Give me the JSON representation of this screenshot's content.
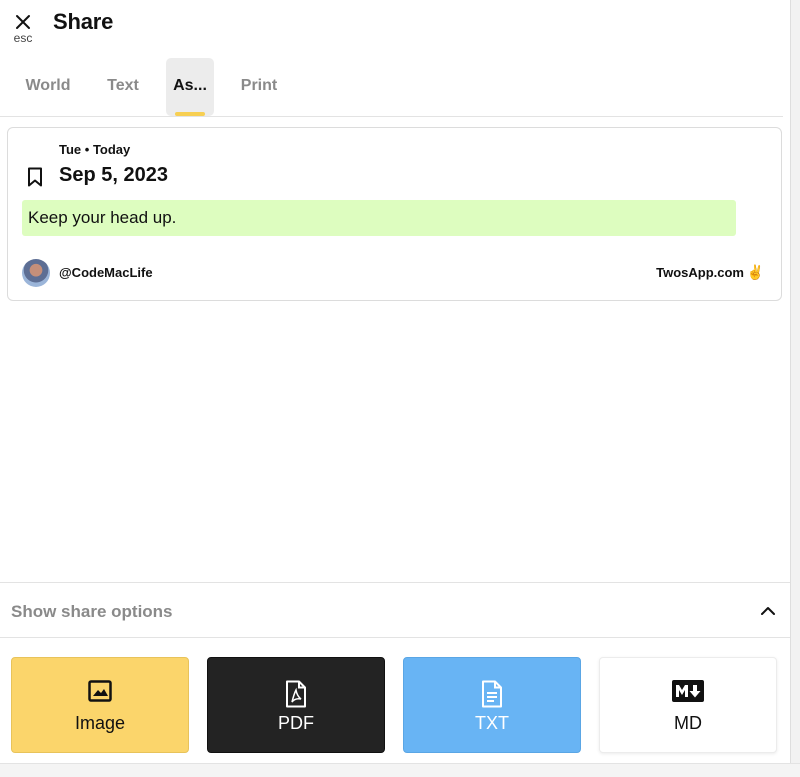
{
  "header": {
    "close_hint": "esc",
    "title": "Share"
  },
  "tabs": [
    {
      "label": "World",
      "active": false
    },
    {
      "label": "Text",
      "active": false
    },
    {
      "label": "As...",
      "active": true
    },
    {
      "label": "Print",
      "active": false
    }
  ],
  "card": {
    "day": "Tue",
    "relative_day": "Today",
    "date": "Sep 5, 2023",
    "note": "Keep your head up.",
    "note_color": "#ddfdbf",
    "user_handle": "@CodeMacLife",
    "site": "TwosApp.com",
    "site_emoji": "✌"
  },
  "share_options": {
    "label": "Show share options"
  },
  "export_buttons": {
    "image": {
      "label": "Image",
      "icon": "image-icon",
      "color": "#fbd56b"
    },
    "pdf": {
      "label": "PDF",
      "icon": "pdf-file-icon",
      "color": "#232323"
    },
    "txt": {
      "label": "TXT",
      "icon": "text-file-icon",
      "color": "#68b4f4"
    },
    "md": {
      "label": "MD",
      "icon": "markdown-icon",
      "color": "#ffffff"
    }
  },
  "accent_color": "#f7cf52"
}
